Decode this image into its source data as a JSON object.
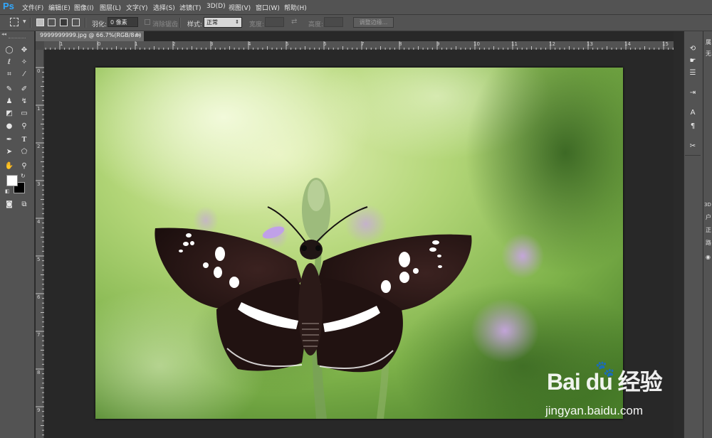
{
  "app": {
    "logo": "Ps"
  },
  "menu": [
    "文件(F)",
    "编辑(E)",
    "图像(I)",
    "图层(L)",
    "文字(Y)",
    "选择(S)",
    "滤镜(T)",
    "3D(D)",
    "视图(V)",
    "窗口(W)",
    "帮助(H)"
  ],
  "options_bar": {
    "feather_label": "羽化:",
    "feather_value": "0 像素",
    "antialias_label": "消除锯齿",
    "style_label": "样式:",
    "style_value": "正常",
    "width_label": "宽度:",
    "height_label": "高度:",
    "refine_edge_button": "调整边缘..."
  },
  "document": {
    "tab_title": "9999999999.jpg @ 66.7%(RGB/8#)",
    "close_glyph": "×"
  },
  "rulers": {
    "horizontal": [
      "1",
      "0",
      "1",
      "2",
      "3",
      "4",
      "5",
      "6",
      "7",
      "8",
      "9",
      "10",
      "11",
      "12",
      "13",
      "14",
      "15"
    ],
    "vertical": [
      "0",
      "1",
      "2",
      "3",
      "4",
      "5",
      "6",
      "7",
      "8",
      "9"
    ]
  },
  "right_panel": {
    "labels": [
      "属",
      "无",
      "3D",
      "户",
      "正",
      "路",
      "◉"
    ]
  },
  "watermark": {
    "logo_text": "Bai du 经验",
    "url": "jingyan.baidu.com"
  },
  "icons": {
    "left_tools": [
      "marquee-icon",
      "move-icon",
      "lasso-icon",
      "magic-wand-icon",
      "crop-icon",
      "eyedropper-icon",
      "healing-brush-icon",
      "brush-icon",
      "clone-stamp-icon",
      "history-brush-icon",
      "eraser-icon",
      "gradient-icon",
      "blur-icon",
      "dodge-icon",
      "pen-icon",
      "type-icon",
      "path-selection-icon",
      "shape-icon",
      "hand-icon",
      "zoom-icon"
    ]
  },
  "colors": {
    "foreground": "#ffffff",
    "background": "#000000",
    "accent_logo": "#31a8ff"
  }
}
